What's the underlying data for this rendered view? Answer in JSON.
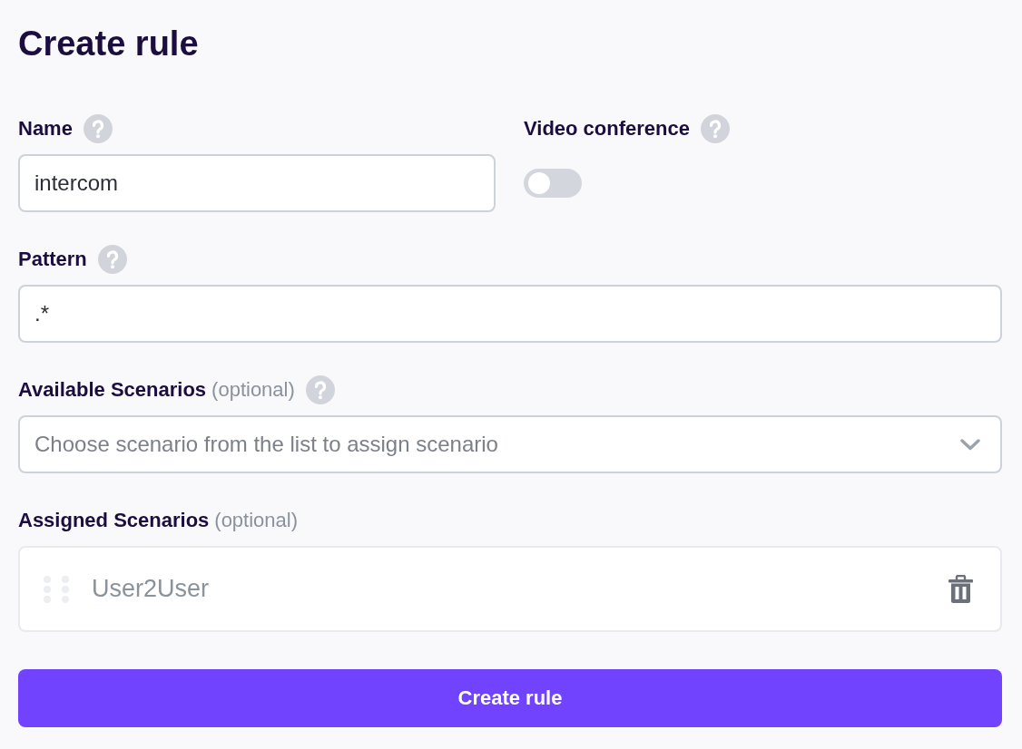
{
  "title": "Create rule",
  "name_field": {
    "label": "Name",
    "has_help": true,
    "value": "intercom"
  },
  "video_conference": {
    "label": "Video conference",
    "has_help": true,
    "on": false
  },
  "pattern_field": {
    "label": "Pattern",
    "has_help": true,
    "value": ".*"
  },
  "available_scenarios": {
    "label": "Available Scenarios",
    "optional_note": "(optional)",
    "has_help": true,
    "placeholder": "Choose scenario from the list to assign scenario"
  },
  "assigned_scenarios": {
    "label": "Assigned Scenarios",
    "optional_note": "(optional)",
    "has_help": false,
    "items": [
      {
        "name": "User2User"
      }
    ]
  },
  "submit_button": {
    "label": "Create rule"
  }
}
